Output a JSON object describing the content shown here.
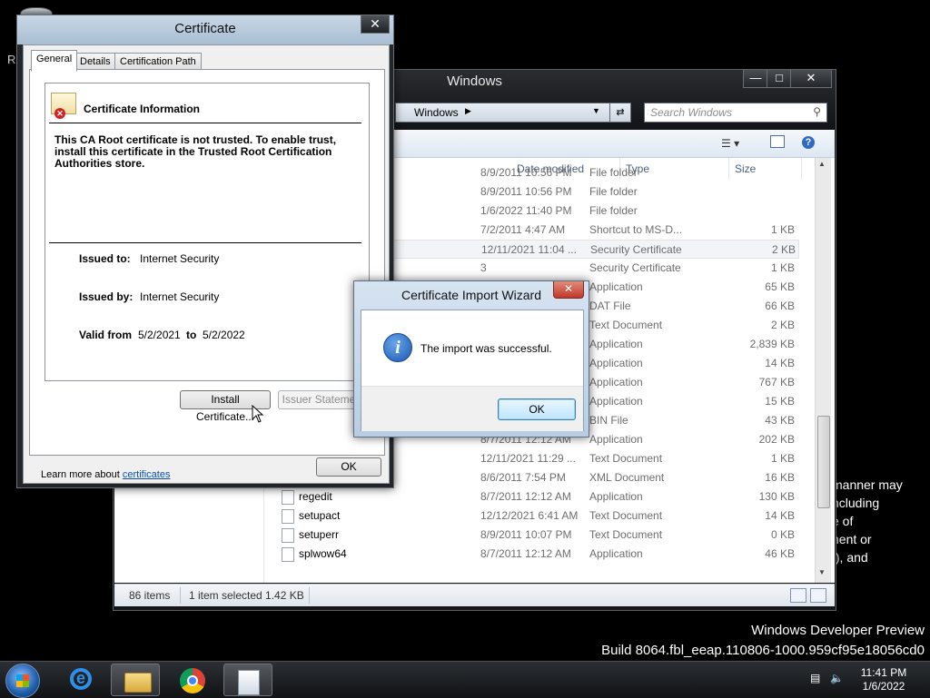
{
  "desktop": {
    "left_letter": "R",
    "partial_text": "manner may\nncluding\ne of\nnent or\nf), and",
    "watermark_line1": "Windows Developer Preview",
    "watermark_line2": "Build 8064.fbl_eeap.110806-1000.959cf95e18056cd0"
  },
  "explorer": {
    "title": "Windows",
    "address": "Windows",
    "search_placeholder": "Search Windows",
    "columns": {
      "date": "Date modified",
      "type": "Type",
      "size": "Size"
    },
    "rows": [
      {
        "name": "",
        "date": "8/9/2011 10:56 PM",
        "type": "File folder",
        "size": ""
      },
      {
        "name": "",
        "date": "8/9/2011 10:56 PM",
        "type": "File folder",
        "size": ""
      },
      {
        "name": "",
        "date": "1/6/2022 11:40 PM",
        "type": "File folder",
        "size": ""
      },
      {
        "name": "",
        "date": "7/2/2011 4:47 AM",
        "type": "Shortcut to MS-D...",
        "size": "1 KB"
      },
      {
        "name": "",
        "date": "12/11/2021 11:04 ...",
        "type": "Security Certificate",
        "size": "2 KB",
        "selected": true
      },
      {
        "name": "",
        "date": "3",
        "type": "Security Certificate",
        "size": "1 KB"
      },
      {
        "name": "",
        "date": "PM",
        "type": "Application",
        "size": "65 KB"
      },
      {
        "name": "",
        "date": "PM",
        "type": "DAT File",
        "size": "66 KB"
      },
      {
        "name": "",
        "date": "AM",
        "type": "Text Document",
        "size": "2 KB"
      },
      {
        "name": "",
        "date": "AM",
        "type": "Application",
        "size": "2,839 KB"
      },
      {
        "name": "",
        "date": "AM",
        "type": "Application",
        "size": "14 KB"
      },
      {
        "name": "",
        "date": "AM",
        "type": "Application",
        "size": "767 KB"
      },
      {
        "name": "",
        "date": "AM",
        "type": "Application",
        "size": "15 KB"
      },
      {
        "name": "",
        "date": "8/6/2011 7:46 PM",
        "type": "BIN File",
        "size": "43 KB"
      },
      {
        "name": "",
        "date": "8/7/2011 12:12 AM",
        "type": "Application",
        "size": "202 KB"
      },
      {
        "name": "",
        "date": "12/11/2021 11:29 ...",
        "type": "Text Document",
        "size": "1 KB"
      },
      {
        "name": "Prerelease",
        "date": "8/6/2011 7:54 PM",
        "type": "XML Document",
        "size": "16 KB"
      },
      {
        "name": "regedit",
        "date": "8/7/2011 12:12 AM",
        "type": "Application",
        "size": "130 KB"
      },
      {
        "name": "setupact",
        "date": "12/12/2021 6:41 AM",
        "type": "Text Document",
        "size": "14 KB"
      },
      {
        "name": "setuperr",
        "date": "8/9/2011 10:07 PM",
        "type": "Text Document",
        "size": "0 KB"
      },
      {
        "name": "splwow64",
        "date": "8/7/2011 12:12 AM",
        "type": "Application",
        "size": "46 KB"
      }
    ],
    "status": {
      "count": "86 items",
      "selected": "1 item selected  1.42 KB"
    }
  },
  "cert": {
    "title": "Certificate",
    "tabs": [
      "General",
      "Details",
      "Certification Path"
    ],
    "info_title": "Certificate Information",
    "warning": "This CA Root certificate is not trusted. To enable trust, install this certificate in the Trusted Root Certification Authorities store.",
    "issued_to_label": "Issued to:",
    "issued_to": "Internet Security",
    "issued_by_label": "Issued by:",
    "issued_by": "Internet Security",
    "valid_from_label": "Valid from",
    "valid_from": "5/2/2021",
    "to_label": "to",
    "valid_to": "5/2/2022",
    "install_btn": "Install Certificate...",
    "issuer_btn": "Issuer Statement",
    "learn_prefix": "Learn more about",
    "learn_link": "certificates",
    "ok_btn": "OK"
  },
  "wizard": {
    "title": "Certificate Import Wizard",
    "message": "The import was successful.",
    "ok_btn": "OK"
  },
  "taskbar": {
    "time": "11:41 PM",
    "date": "1/6/2022"
  }
}
